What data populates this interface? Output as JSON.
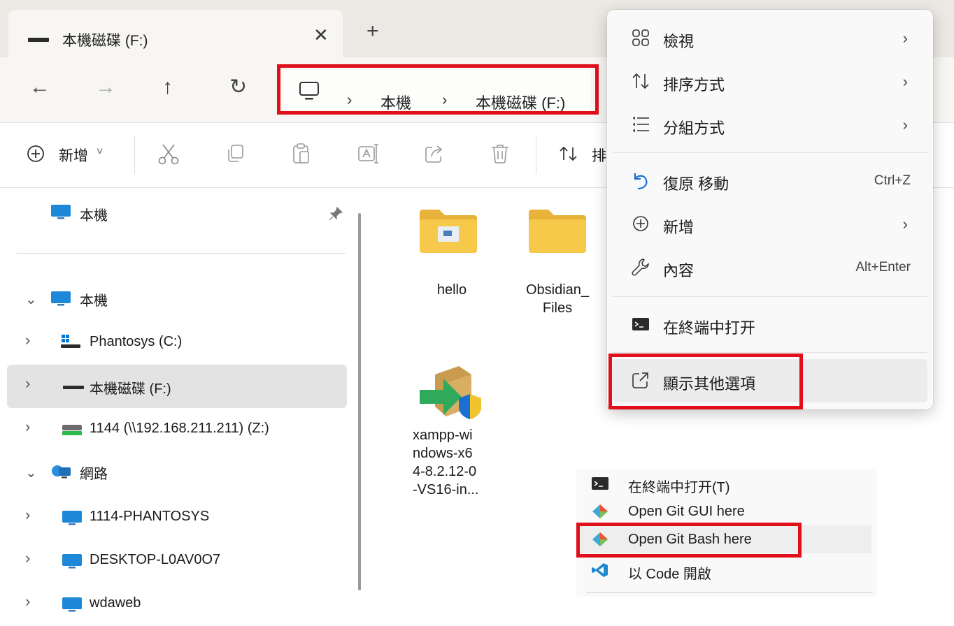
{
  "tab": {
    "title": "本機磁碟 (F:)",
    "close": "✕",
    "new_tab": "+"
  },
  "nav": {
    "back": "←",
    "forward": "→",
    "up": "↑",
    "refresh": "↻"
  },
  "breadcrumb": {
    "separator": "›",
    "items": [
      "本機",
      "本機磁碟 (F:)"
    ]
  },
  "toolbar": {
    "new_label": "新增",
    "new_dropdown": "˅",
    "sort_label_partial": "排"
  },
  "sidebar": {
    "pinned": {
      "label": "本機",
      "pin": "📌"
    },
    "tree": [
      {
        "label": "本機",
        "expanded": true,
        "icon": "monitor-icon"
      },
      {
        "label": "Phantosys (C:)",
        "expanded": false,
        "icon": "windows-drive-icon"
      },
      {
        "label": "本機磁碟 (F:)",
        "expanded": false,
        "selected": true,
        "icon": "drive-icon"
      },
      {
        "label": "1144 (\\\\192.168.211.211) (Z:)",
        "expanded": false,
        "icon": "network-drive-icon"
      },
      {
        "label": "網路",
        "expanded": true,
        "icon": "network-icon"
      },
      {
        "label": "1114-PHANTOSYS",
        "expanded": false,
        "icon": "monitor-icon"
      },
      {
        "label": "DESKTOP-L0AV0O7",
        "expanded": false,
        "icon": "monitor-icon"
      },
      {
        "label": "wdaweb",
        "expanded": false,
        "icon": "monitor-icon"
      }
    ]
  },
  "files": [
    {
      "name": "hello",
      "icon": "folder-icon"
    },
    {
      "name": "Obsidian_\nFiles",
      "icon": "folder-icon"
    },
    {
      "name": "xampp-wi\nndows-x6\n4-8.2.12-0\n-VS16-in...",
      "icon": "installer-icon"
    }
  ],
  "context_menu": {
    "items": [
      {
        "label": "檢視",
        "icon": "view-icon",
        "submenu": true
      },
      {
        "label": "排序方式",
        "icon": "sort-icon",
        "submenu": true
      },
      {
        "label": "分組方式",
        "icon": "group-icon",
        "submenu": true
      },
      {
        "label": "復原 移動",
        "icon": "undo-icon",
        "shortcut": "Ctrl+Z"
      },
      {
        "label": "新增",
        "icon": "add-icon",
        "submenu": true
      },
      {
        "label": "內容",
        "icon": "properties-icon",
        "shortcut": "Alt+Enter"
      },
      {
        "label": "在終端中打开",
        "icon": "terminal-icon"
      },
      {
        "label": "顯示其他選項",
        "icon": "show-more-icon"
      }
    ],
    "submenu_arrow": "›"
  },
  "classic_menu": {
    "items": [
      {
        "label": "在終端中打开(T)",
        "icon": "terminal-icon"
      },
      {
        "label": "Open Git GUI here",
        "icon": "git-icon"
      },
      {
        "label": "Open Git Bash here",
        "icon": "git-icon"
      },
      {
        "label": "以 Code 開啟",
        "icon": "vscode-icon"
      }
    ]
  },
  "colors": {
    "highlight": "#e0101b",
    "accent": "#0067c0"
  }
}
